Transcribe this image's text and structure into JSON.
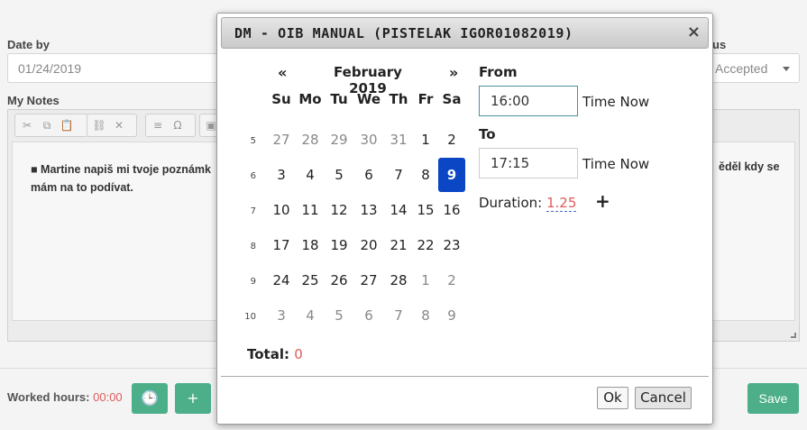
{
  "page": {
    "date_by_label": "Date by",
    "date_by_value": "01/24/2019",
    "status_label_partial": "us",
    "status_value": "Accepted",
    "my_notes_label": "My Notes",
    "note_text_partial": "Martine napiš mi tvoje poznámk",
    "note_text_right": "ěděl kdy se",
    "note_text_line2": "mám na to podívat.",
    "worked_hours_label": "Worked hours:",
    "worked_hours_value": "00:00",
    "save_label": "Save"
  },
  "modal": {
    "title": "DM - OIB MANUAL (PISTELAK IGOR01082019)",
    "close_glyph": "×",
    "calendar": {
      "prev": "«",
      "next": "»",
      "month_label": "February 2019",
      "weekdays": [
        "Su",
        "Mo",
        "Tu",
        "We",
        "Th",
        "Fr",
        "Sa"
      ],
      "weeks": [
        {
          "num": "5",
          "days": [
            "27",
            "28",
            "29",
            "30",
            "31",
            "1",
            "2"
          ]
        },
        {
          "num": "6",
          "days": [
            "3",
            "4",
            "5",
            "6",
            "7",
            "8",
            "9"
          ]
        },
        {
          "num": "7",
          "days": [
            "10",
            "11",
            "12",
            "13",
            "14",
            "15",
            "16"
          ]
        },
        {
          "num": "8",
          "days": [
            "17",
            "18",
            "19",
            "20",
            "21",
            "22",
            "23"
          ]
        },
        {
          "num": "9",
          "days": [
            "24",
            "25",
            "26",
            "27",
            "28",
            "1",
            "2"
          ]
        },
        {
          "num": "10",
          "days": [
            "3",
            "4",
            "5",
            "6",
            "7",
            "8",
            "9"
          ]
        }
      ],
      "selected": "9"
    },
    "from_label": "From",
    "from_value": "16:00",
    "to_label": "To",
    "to_value": "17:15",
    "time_now_label": "Time Now",
    "duration_label": "Duration:",
    "duration_value": "1.25",
    "add_glyph": "+",
    "total_label": "Total:",
    "total_value": "0",
    "ok_label": "Ok",
    "cancel_label": "Cancel"
  },
  "colors": {
    "accent_green": "#4caf8a",
    "selected_blue": "#0b46c4",
    "value_red": "#e05b5b"
  }
}
